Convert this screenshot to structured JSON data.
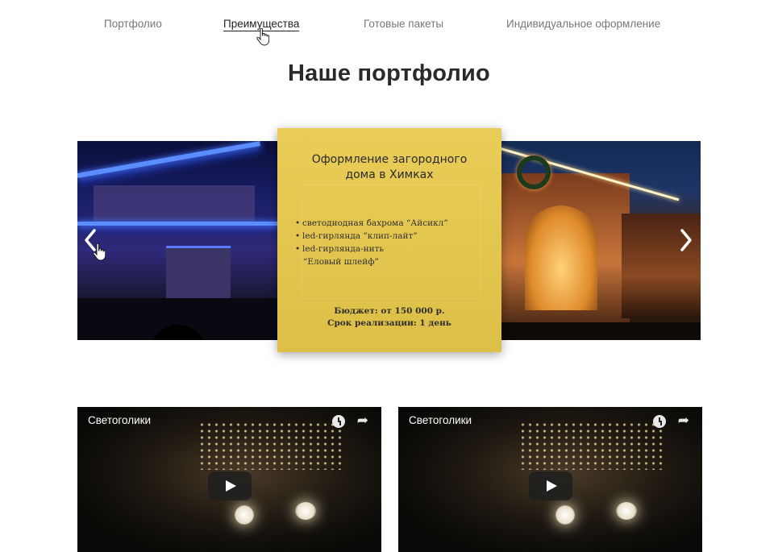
{
  "nav": {
    "items": [
      {
        "label": "Портфолио"
      },
      {
        "label": "Преимущества"
      },
      {
        "label": "Готовые пакеты"
      },
      {
        "label": "Индивидуальное оформление"
      }
    ],
    "active_index": 1
  },
  "page_title": "Наше портфолио",
  "slider": {
    "prev_icon": "chevron-left-icon",
    "next_icon": "chevron-right-icon",
    "card": {
      "title_line1": "Оформление загородного",
      "title_line2": "дома в Химках",
      "features": [
        "светодиодная бахрома “Айсикл”",
        "led-гирлянда ”клип-лайт”",
        "led-гирлянда-нить"
      ],
      "feature_continuation": "“Еловый шлейф”",
      "budget": "Бюджет: от 150 000 р.",
      "duration": "Срок реализации: 1 день"
    }
  },
  "videos": [
    {
      "title": "Светоголики",
      "icons": [
        "clock-icon",
        "share-icon",
        "play-icon"
      ]
    },
    {
      "title": "Светоголики",
      "icons": [
        "clock-icon",
        "share-icon",
        "play-icon"
      ]
    }
  ],
  "colors": {
    "card_bg": "#e8c94a",
    "nav_text": "#777777",
    "nav_active": "#222222",
    "title": "#2a2a2a"
  }
}
